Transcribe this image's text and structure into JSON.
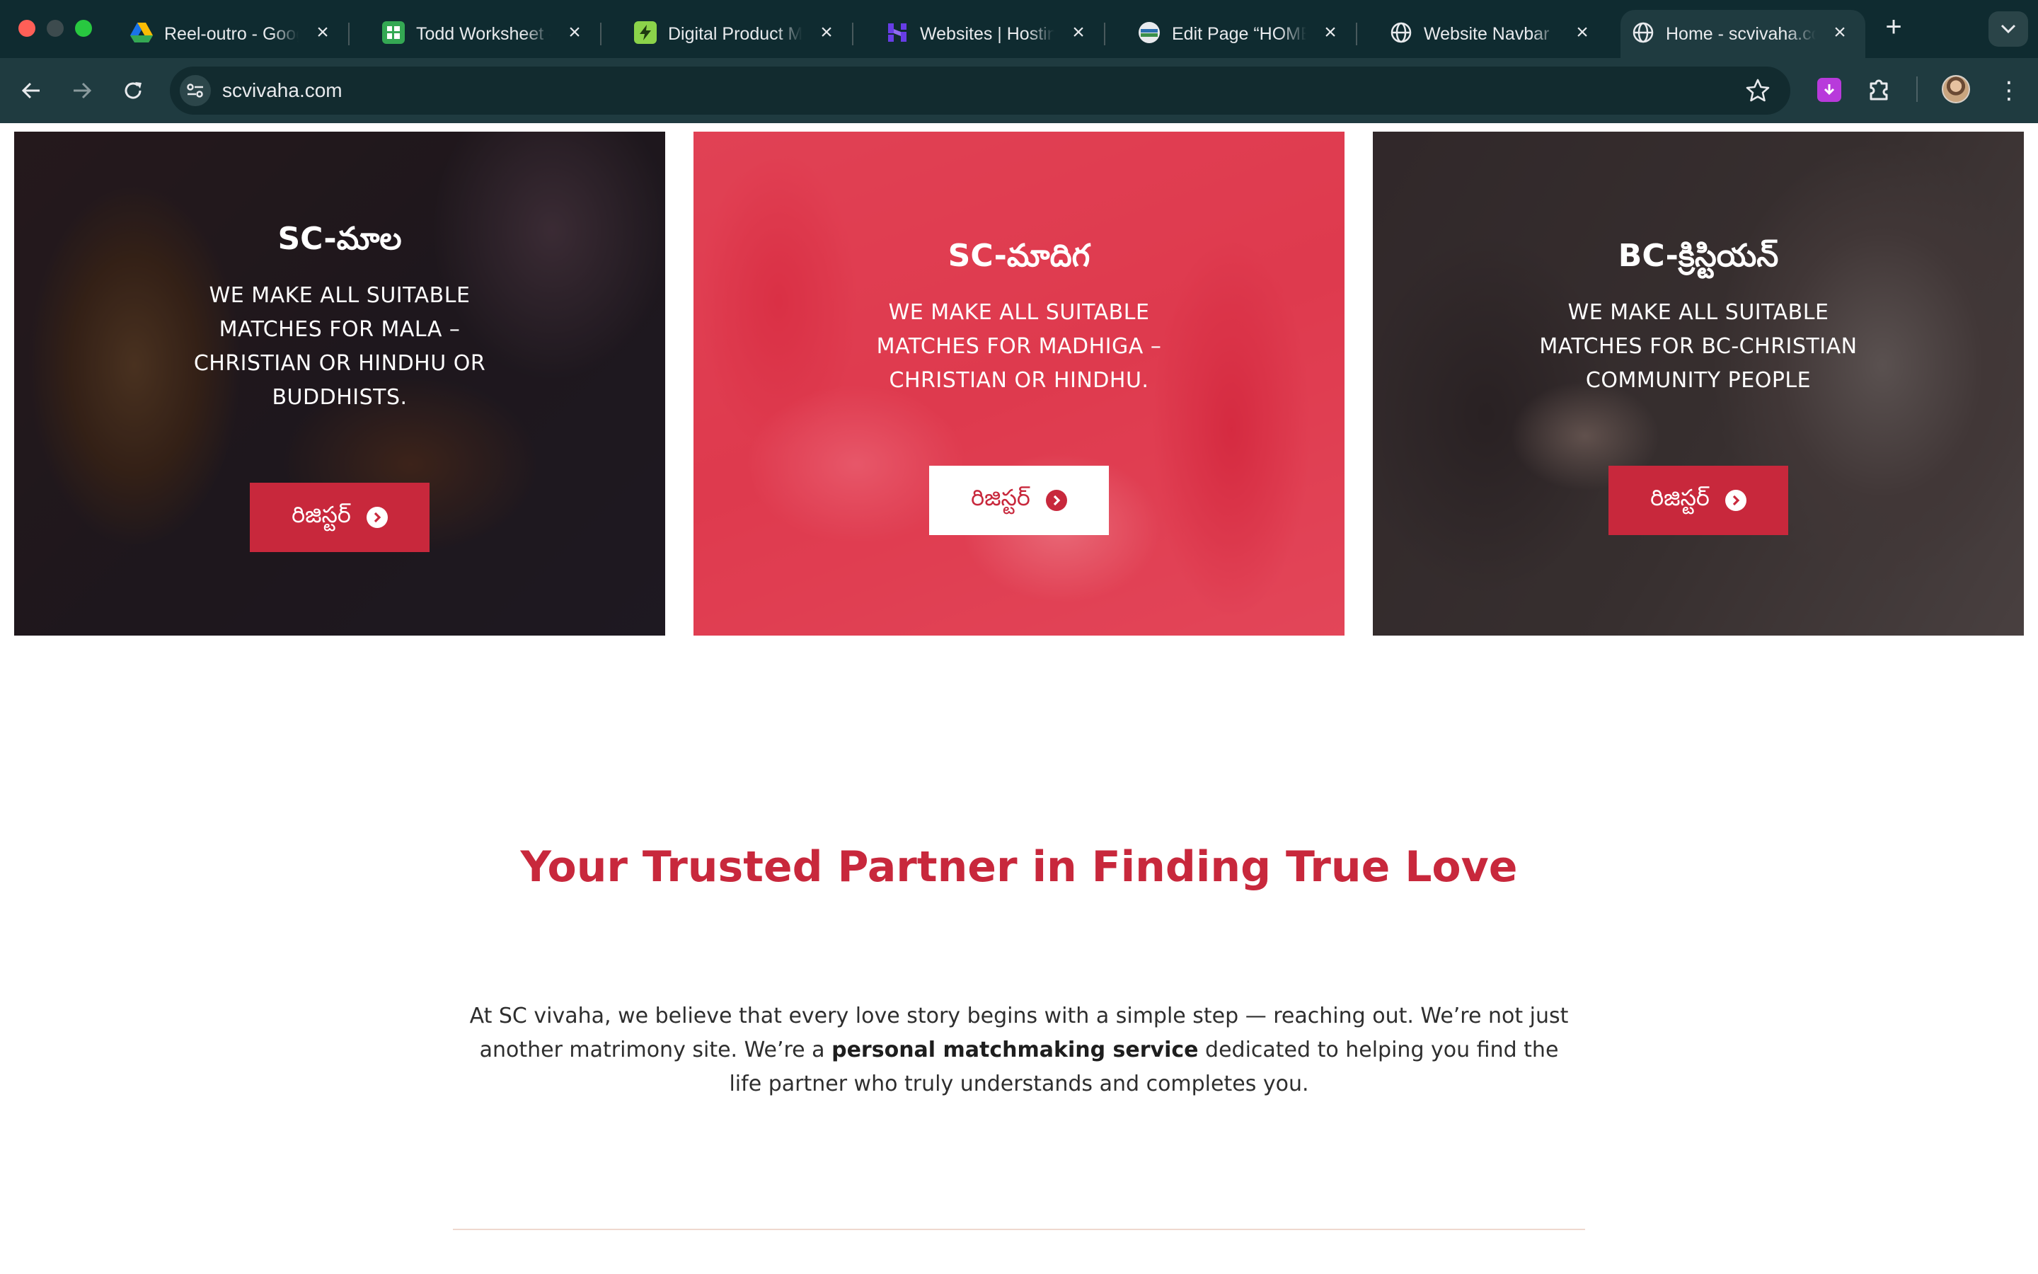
{
  "browser": {
    "tabs": [
      {
        "title": "Reel-outro - Google Drive",
        "icon": "google-drive-icon",
        "active": false
      },
      {
        "title": "Todd Worksheet - Google Sheets",
        "icon": "google-sheets-icon",
        "active": false
      },
      {
        "title": "Digital Product Models",
        "icon": "lightning-app-icon",
        "active": false
      },
      {
        "title": "Websites | Hostinger",
        "icon": "hostinger-icon",
        "active": false
      },
      {
        "title": "Edit Page “HOME”",
        "icon": "editor-site-icon",
        "active": false
      },
      {
        "title": "Website Navbar",
        "icon": "globe-icon",
        "active": false
      },
      {
        "title": "Home - scvivaha.com",
        "icon": "globe-icon",
        "active": true
      }
    ],
    "url": "scvivaha.com"
  },
  "cards": [
    {
      "title": "SC-మాల",
      "description": "WE MAKE ALL SUITABLE MATCHES FOR MALA – CHRISTIAN OR HINDHU OR BUDDHISTS.",
      "button": "రిజిస్టర్"
    },
    {
      "title": "SC-మాదిగ",
      "description": "WE MAKE ALL SUITABLE MATCHES FOR MADHIGA – CHRISTIAN OR HINDHU.",
      "button": "రిజిస్టర్"
    },
    {
      "title": "BC-క్రిస్టియన్",
      "description": "WE MAKE ALL SUITABLE MATCHES FOR BC-CHRISTIAN COMMUNITY PEOPLE",
      "button": "రిజిస్టర్"
    }
  ],
  "section": {
    "headline": "Your Trusted Partner in Finding True Love",
    "intro_before": "At SC vivaha, we believe that every love story begins with a simple step — reaching out. We’re not just another matrimony site. We’re a ",
    "intro_bold": "personal matchmaking service",
    "intro_after": " dedicated to helping you find the life partner who truly understands and completes you."
  },
  "colors": {
    "brand_red": "#c8283c",
    "tabbar": "#0f2b30",
    "toolbar": "#1f3b40"
  }
}
